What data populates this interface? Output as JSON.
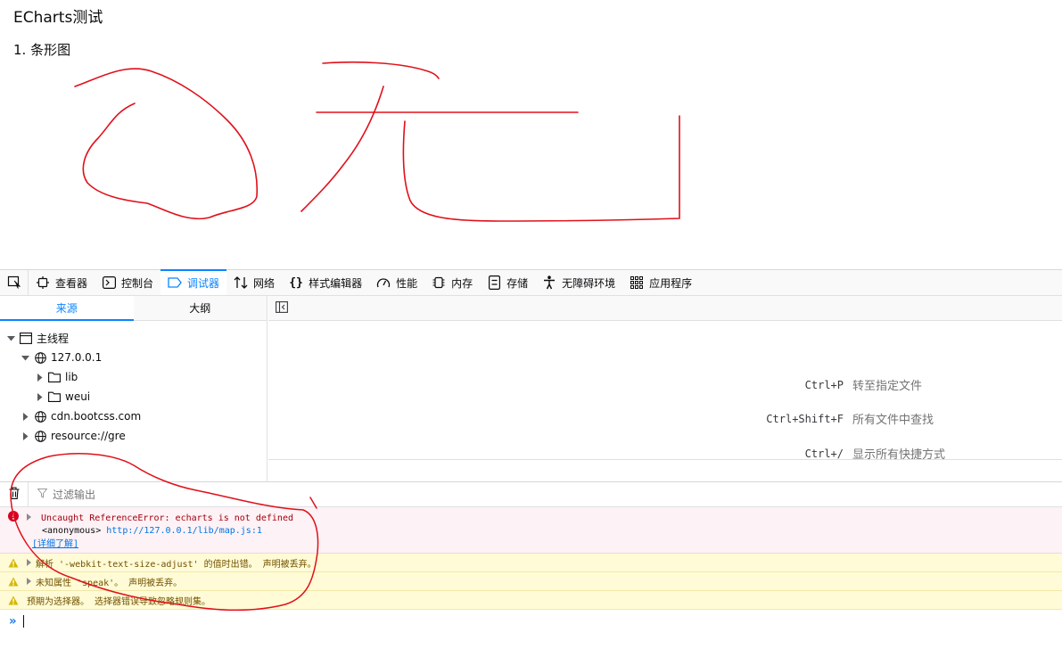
{
  "page": {
    "title": "ECharts测试",
    "section": "1. 条形图"
  },
  "devtools": {
    "tabs": [
      {
        "label": "查看器",
        "icon": "inspector-icon"
      },
      {
        "label": "控制台",
        "icon": "console-icon"
      },
      {
        "label": "调试器",
        "icon": "debugger-icon",
        "active": true
      },
      {
        "label": "网络",
        "icon": "network-icon"
      },
      {
        "label": "样式编辑器",
        "icon": "style-editor-icon"
      },
      {
        "label": "性能",
        "icon": "performance-icon"
      },
      {
        "label": "内存",
        "icon": "memory-icon"
      },
      {
        "label": "存储",
        "icon": "storage-icon"
      },
      {
        "label": "无障碍环境",
        "icon": "accessibility-icon"
      },
      {
        "label": "应用程序",
        "icon": "application-icon"
      }
    ],
    "accent": "#0a84ff"
  },
  "sources": {
    "tabs": [
      "来源",
      "大纲"
    ],
    "tree": {
      "main_thread": "主线程",
      "host": "127.0.0.1",
      "folder_lib": "lib",
      "folder_weui": "weui",
      "cdn": "cdn.bootcss.com",
      "resource": "resource://gre"
    }
  },
  "editor": {
    "shortcuts": [
      {
        "key": "Ctrl+P",
        "desc": "转至指定文件"
      },
      {
        "key": "Ctrl+Shift+F",
        "desc": "所有文件中查找"
      },
      {
        "key": "Ctrl+/",
        "desc": "显示所有快捷方式"
      }
    ]
  },
  "console": {
    "filter_placeholder": "过滤输出",
    "error": {
      "message": "Uncaught ReferenceError: echarts is not defined",
      "frame": "<anonymous>",
      "url": "http://127.0.0.1/lib/map.js:1",
      "learn_more": "[详细了解]"
    },
    "warnings": [
      "解析 '-webkit-text-size-adjust' 的值时出错。  声明被丢弃。",
      "未知属性 'speak'。  声明被丢弃。",
      "预期为选择器。  选择器错误导致忽略规则集。"
    ],
    "colors": {
      "error": "#a4000f",
      "warning": "#715100",
      "link": "#0074e8"
    }
  }
}
